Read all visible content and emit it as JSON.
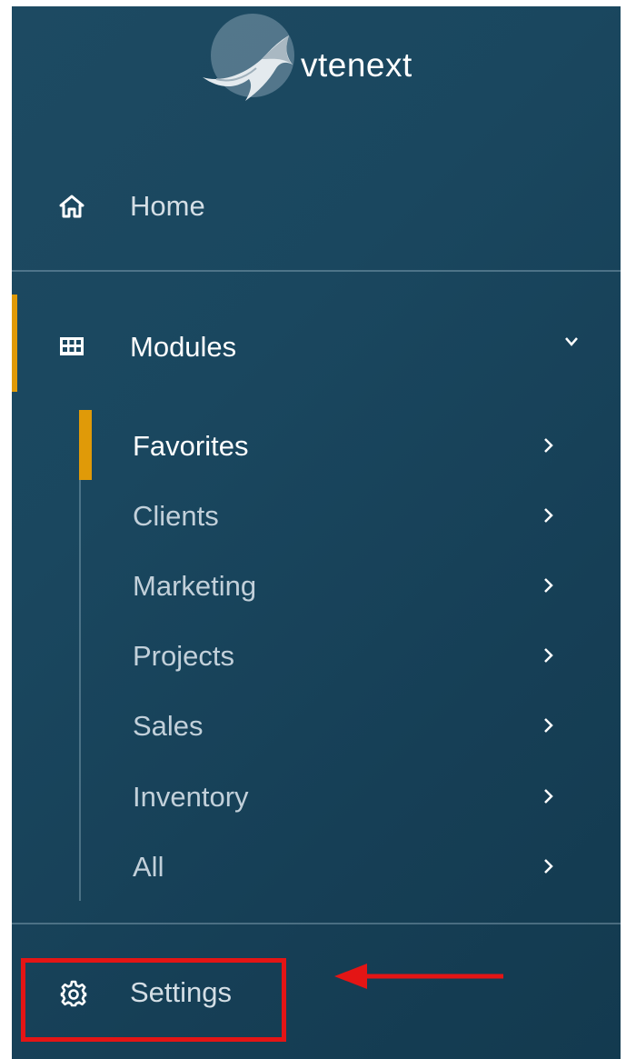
{
  "brand": {
    "name": "vtenext",
    "icon": "shark-logo"
  },
  "nav": {
    "home": {
      "label": "Home",
      "icon": "home-icon"
    },
    "modules": {
      "label": "Modules",
      "icon": "grid-icon",
      "expanded": true,
      "items": [
        {
          "label": "Favorites",
          "active": true
        },
        {
          "label": "Clients",
          "active": false
        },
        {
          "label": "Marketing",
          "active": false
        },
        {
          "label": "Projects",
          "active": false
        },
        {
          "label": "Sales",
          "active": false
        },
        {
          "label": "Inventory",
          "active": false
        },
        {
          "label": "All",
          "active": false
        }
      ]
    },
    "settings": {
      "label": "Settings",
      "icon": "gear-icon"
    }
  },
  "colors": {
    "sidebar_bg": "#1a475f",
    "accent": "#e09a08",
    "highlight": "#e41515"
  }
}
